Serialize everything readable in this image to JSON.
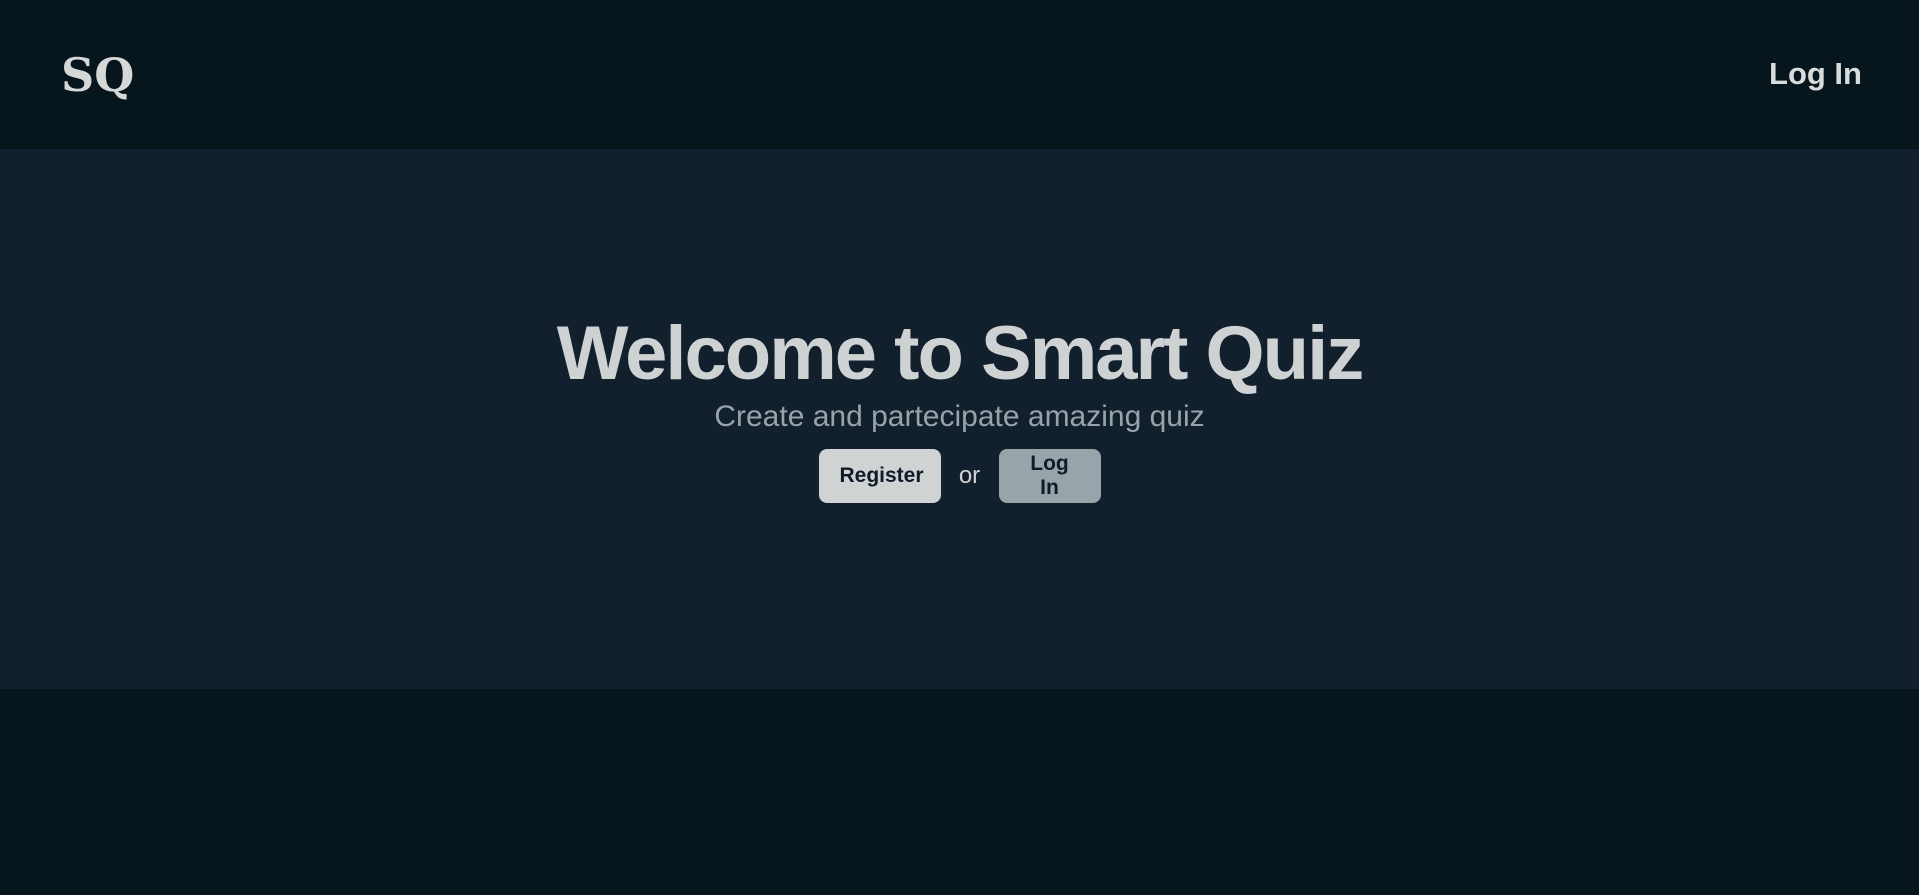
{
  "header": {
    "logo_text": "SQ",
    "nav_login_label": "Log In"
  },
  "hero": {
    "title": "Welcome to Smart Quiz",
    "subtitle": "Create and partecipate amazing quiz",
    "register_label": "Register",
    "or_text": "or",
    "login_label": "Log In"
  },
  "colors": {
    "page_background": "#07151d",
    "hero_background": "#121f2d",
    "primary_text": "#cfd3d3",
    "secondary_text": "#96a4aa",
    "register_button": "#cfd3d3",
    "login_button": "#97a4a9"
  }
}
